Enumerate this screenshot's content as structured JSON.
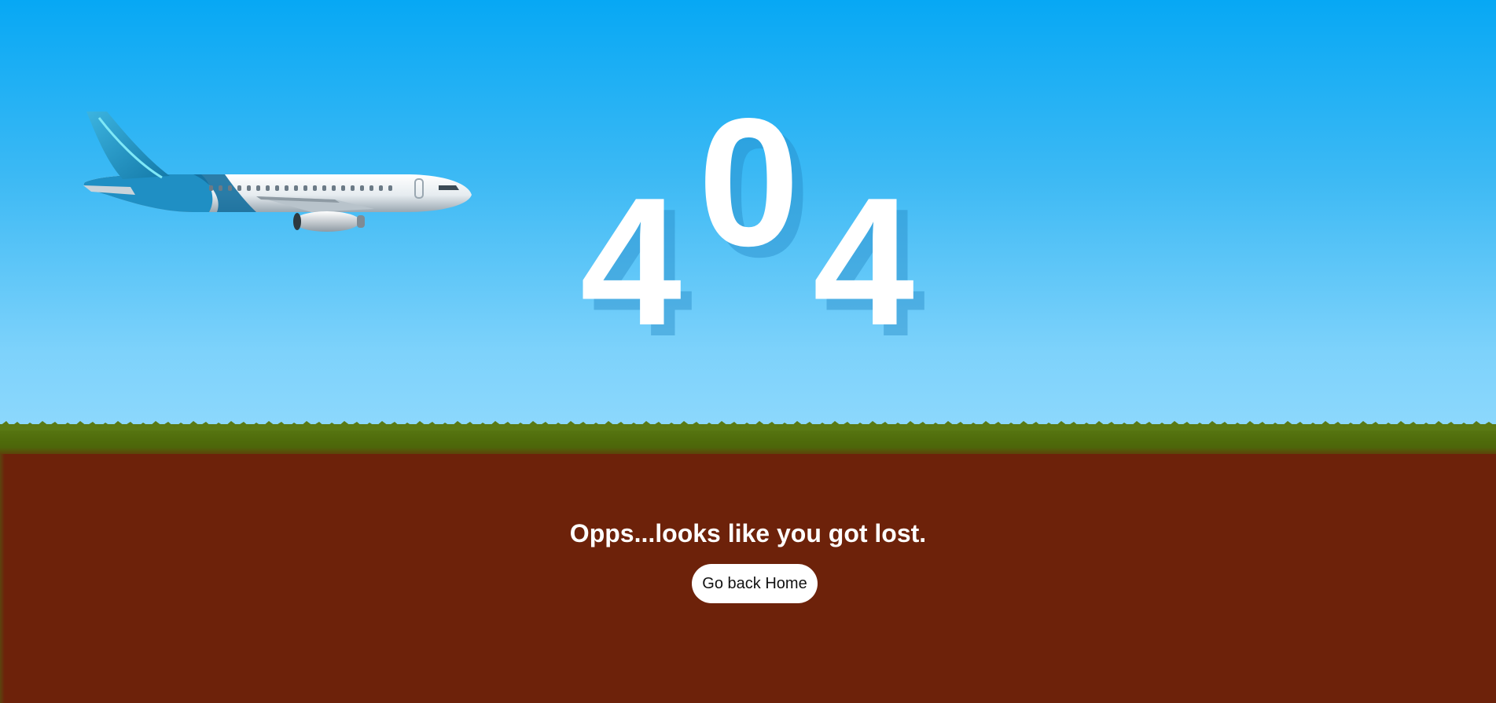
{
  "error_code": {
    "digit_1": "4",
    "digit_2": "0",
    "digit_3": "4"
  },
  "message": "Opps...looks like you got lost.",
  "home_button": {
    "label": "Go back Home"
  },
  "scene": {
    "illustration": "airplane-icon",
    "sky_color": "#07a8f4",
    "sky_horizon_color": "#8fd9fd",
    "grass_color": "#4e6a0a",
    "soil_color": "#6d220a",
    "digit_color": "#ffffff",
    "button_background": "#ffffff"
  }
}
